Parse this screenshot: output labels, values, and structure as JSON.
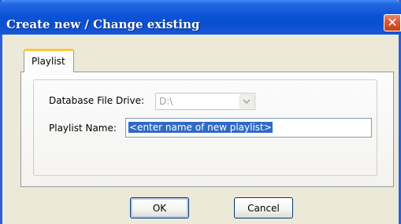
{
  "window": {
    "title": "Create new / Change existing",
    "close_glyph": "✕"
  },
  "tabs": [
    {
      "label": "Playlist",
      "active": true
    }
  ],
  "form": {
    "drive_label": "Database File Drive:",
    "drive_value": "D:\\",
    "drive_arrow_icon": "chevron-down-icon",
    "playlist_label": "Playlist Name:",
    "playlist_value": "<enter name of new playlist>"
  },
  "buttons": {
    "ok_label": "OK",
    "cancel_label": "Cancel"
  },
  "colors": {
    "titlebar": "#0b4fd0",
    "close": "#d9542e",
    "selection": "#316ac5",
    "tab_highlight": "#ffc83c"
  }
}
